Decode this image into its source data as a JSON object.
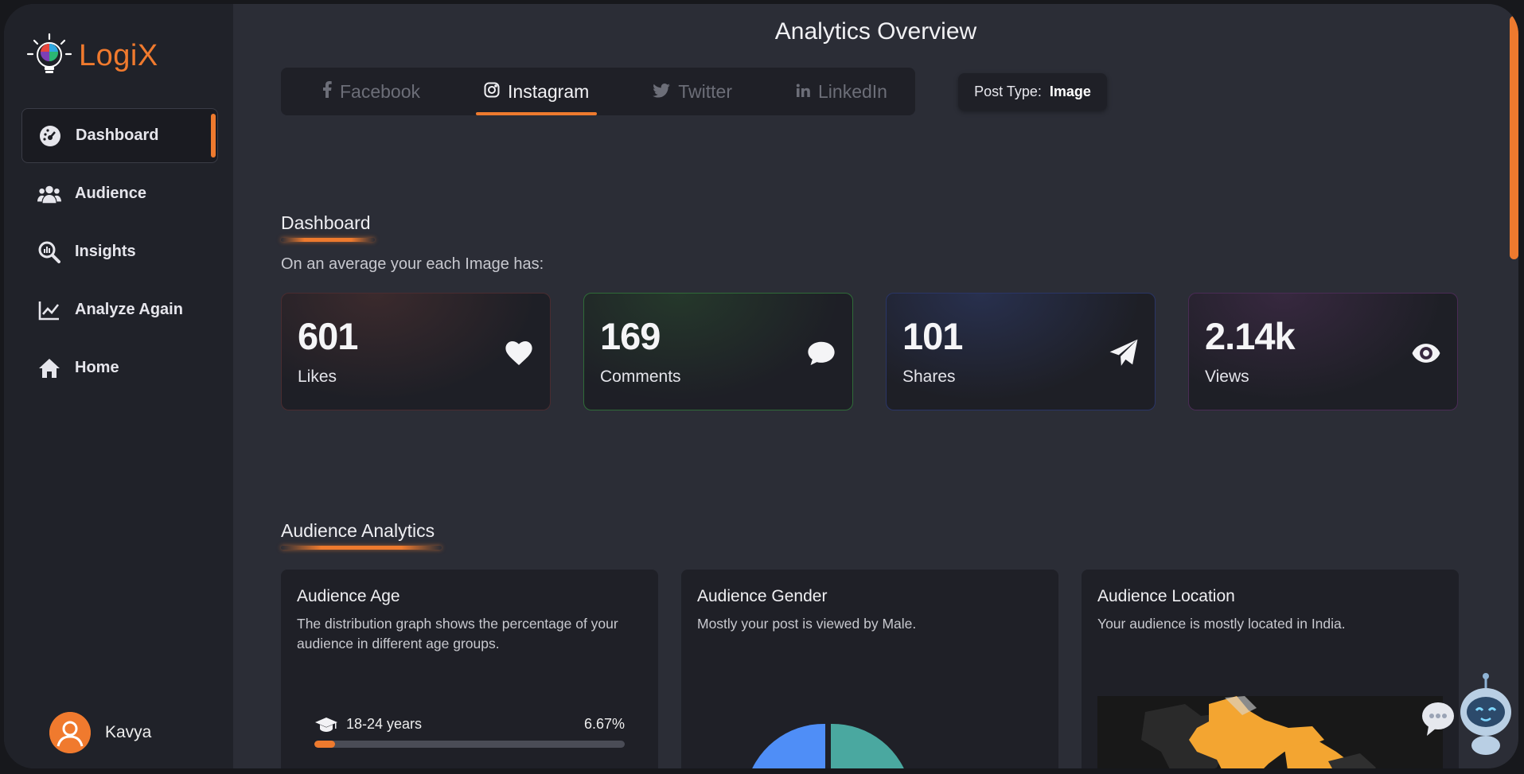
{
  "app": {
    "name": "LogiX",
    "accent": "#ee7a2e"
  },
  "sidebar": {
    "items": [
      {
        "label": "Dashboard",
        "icon": "dashboard-gauge-icon",
        "active": true
      },
      {
        "label": "Audience",
        "icon": "users-icon"
      },
      {
        "label": "Insights",
        "icon": "magnify-chart-icon"
      },
      {
        "label": "Analyze Again",
        "icon": "line-chart-icon"
      },
      {
        "label": "Home",
        "icon": "home-icon"
      }
    ],
    "user": {
      "name": "Kavya"
    }
  },
  "header": {
    "title": "Analytics Overview"
  },
  "platform_tabs": [
    {
      "label": "Facebook",
      "icon": "facebook-icon"
    },
    {
      "label": "Instagram",
      "icon": "instagram-icon",
      "active": true
    },
    {
      "label": "Twitter",
      "icon": "twitter-icon"
    },
    {
      "label": "LinkedIn",
      "icon": "linkedin-icon"
    }
  ],
  "post_type": {
    "label": "Post Type:",
    "value": "Image"
  },
  "dashboard": {
    "title": "Dashboard",
    "subtitle": "On an average your each Image has:",
    "stats": [
      {
        "value": "601",
        "label": "Likes",
        "icon": "heart-icon",
        "color": "#e85a6a"
      },
      {
        "value": "169",
        "label": "Comments",
        "icon": "comment-icon",
        "color": "#4caf50"
      },
      {
        "value": "101",
        "label": "Shares",
        "icon": "paper-plane-icon",
        "color": "#4a63d6"
      },
      {
        "value": "2.14k",
        "label": "Views",
        "icon": "eye-icon",
        "color": "#9c4fc4"
      }
    ]
  },
  "audience": {
    "title": "Audience Analytics",
    "age": {
      "title": "Audience Age",
      "description": "The distribution graph shows the percentage of your audience in different age groups.",
      "groups": [
        {
          "label": "18-24 years",
          "percent": "6.67%",
          "fraction": 0.0667
        }
      ]
    },
    "gender": {
      "title": "Audience Gender",
      "description": "Mostly your post is viewed by Male.",
      "colors": {
        "male": "#4f8ef7",
        "female": "#4aa8a0"
      }
    },
    "location": {
      "title": "Audience Location",
      "description": "Your audience is mostly located in India.",
      "highlight_color": "#f3a531"
    }
  }
}
